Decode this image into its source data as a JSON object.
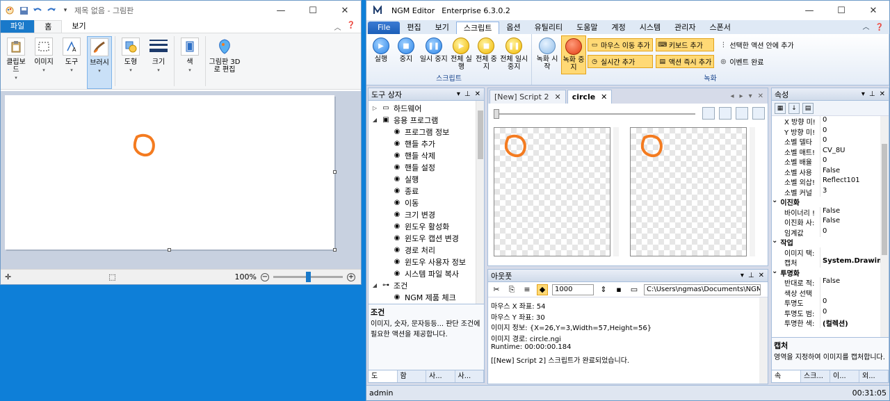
{
  "paint": {
    "title": "제목 없음 - 그림판",
    "tabs": [
      "파일",
      "홈",
      "보기"
    ],
    "groups": [
      {
        "label": "클립보드",
        "icon": "clipboard-icon"
      },
      {
        "label": "이미지",
        "icon": "image-select-icon"
      },
      {
        "label": "도구",
        "icon": "tools-icon"
      },
      {
        "label": "브러시",
        "icon": "brush-icon"
      },
      {
        "label": "도형",
        "icon": "shapes-icon"
      },
      {
        "label": "크기",
        "icon": "size-icon"
      },
      {
        "label": "색",
        "icon": "color-icon"
      },
      {
        "label": "그림판 3D로 편집",
        "icon": "paint3d-icon"
      }
    ],
    "zoom": "100%",
    "zoom_slider_fraction": 0.5
  },
  "ngm": {
    "title": "NGM Editor",
    "version": "Enterprise 6.3.0.2",
    "menu_tabs": [
      "File",
      "편집",
      "보기",
      "스크립트",
      "옵션",
      "유틸리티",
      "도움말",
      "계정",
      "시스템",
      "관리자",
      "스폰서"
    ],
    "ribbon": {
      "script_buttons": [
        "실행",
        "중지",
        "일시 중지",
        "전체 실행",
        "전체 중지",
        "전체 일시 중지"
      ],
      "script_group": "스크립트",
      "record_buttons": [
        "녹화 시작",
        "녹화 중지"
      ],
      "record_small": [
        "마우스 이동 추가",
        "키보드 추가",
        "선택한 액션 안에 추가",
        "실시간 추가",
        "액션 즉시 추가",
        "이벤트 완료"
      ],
      "record_group": "녹화"
    },
    "toolbox": {
      "title": "도구 상자",
      "nodes": [
        {
          "label": "하드웨어",
          "level": 0,
          "exp": "▷",
          "icon": "hardware-icon"
        },
        {
          "label": "응용 프로그램",
          "level": 0,
          "exp": "◢",
          "icon": "application-icon"
        },
        {
          "label": "프로그램 정보",
          "level": 1,
          "icon": "program-info-icon"
        },
        {
          "label": "핸들 추가",
          "level": 1,
          "icon": "handle-add-icon"
        },
        {
          "label": "핸들 삭제",
          "level": 1,
          "icon": "handle-delete-icon"
        },
        {
          "label": "핸들 설정",
          "level": 1,
          "icon": "handle-set-icon"
        },
        {
          "label": "실행",
          "level": 1,
          "icon": "run-icon"
        },
        {
          "label": "종료",
          "level": 1,
          "icon": "exit-icon"
        },
        {
          "label": "이동",
          "level": 1,
          "icon": "move-icon"
        },
        {
          "label": "크기 변경",
          "level": 1,
          "icon": "resize-icon"
        },
        {
          "label": "윈도우 활성화",
          "level": 1,
          "icon": "window-activate-icon"
        },
        {
          "label": "윈도우 캡션 변경",
          "level": 1,
          "icon": "window-caption-icon"
        },
        {
          "label": "경로 처리",
          "level": 1,
          "icon": "path-icon"
        },
        {
          "label": "윈도우 사용자 정보",
          "level": 1,
          "icon": "user-info-icon"
        },
        {
          "label": "시스템 파일 복사",
          "level": 1,
          "icon": "file-copy-icon"
        },
        {
          "label": "조건",
          "level": 0,
          "exp": "◢",
          "icon": "condition-icon"
        },
        {
          "label": "NGM 제품 체크",
          "level": 1,
          "icon": "product-check-icon"
        }
      ],
      "desc_title": "조건",
      "desc_text": "이미지, 숫자, 문자등등... 판단 조건에 필요한 액션을 제공합니다.",
      "bottom_tabs": [
        "도",
        "함",
        "사...",
        "사..."
      ]
    },
    "docs": {
      "tabs": [
        "[New] Script 2",
        "circle"
      ]
    },
    "output": {
      "title": "아웃풋",
      "value": "1000",
      "path": "C:\\Users\\ngmas\\Documents\\NGM6\\",
      "lines": [
        "마우스 X 좌표: 54",
        "마우스 Y 좌표: 30",
        "이미지 정보: {X=26,Y=3,Width=57,Height=56}",
        "이미지 경로: circle.ngi",
        "Runtime: 00:00:00.184",
        "[[New] Script 2] 스크립트가 완료되었습니다."
      ]
    },
    "properties": {
      "title": "속성",
      "rows": [
        {
          "k": "X 방향 미!",
          "v": "0"
        },
        {
          "k": "Y 방향 미!",
          "v": "0"
        },
        {
          "k": "소벨 델타",
          "v": "0"
        },
        {
          "k": "소벨 매트!",
          "v": "CV_8U"
        },
        {
          "k": "소벨 배율",
          "v": "0"
        },
        {
          "k": "소벨 사용",
          "v": "False"
        },
        {
          "k": "소벨 외삽!",
          "v": "Reflect101"
        },
        {
          "k": "소벨 커널",
          "v": "3"
        },
        {
          "cat": "이진화"
        },
        {
          "k": "바이너리 !",
          "v": "False"
        },
        {
          "k": "이진화 사:",
          "v": "False"
        },
        {
          "k": "임계값",
          "v": "0"
        },
        {
          "cat": "작업"
        },
        {
          "k": "이미지 택:",
          "v": ""
        },
        {
          "k": "캡처",
          "v": "System.Drawin",
          "bold": true
        },
        {
          "cat": "투명화"
        },
        {
          "k": "반대로 적:",
          "v": "False"
        },
        {
          "k": "색상 선택",
          "v": ""
        },
        {
          "k": "투명도",
          "v": "0"
        },
        {
          "k": "투명도 범:",
          "v": "0"
        },
        {
          "k": "투명한 색:",
          "v": "(컬렉션)",
          "bold": true
        }
      ],
      "desc_title": "캡처",
      "desc_text": "영역을 지정하여 이미지를 캡처합니다.",
      "bottom_tabs": [
        "속",
        "스크...",
        "이...",
        "외..."
      ]
    },
    "status": {
      "user": "admin",
      "time": "00:31:05"
    },
    "colors": {
      "circle_stroke": "#f47b20",
      "accent": "#1979ca"
    }
  }
}
